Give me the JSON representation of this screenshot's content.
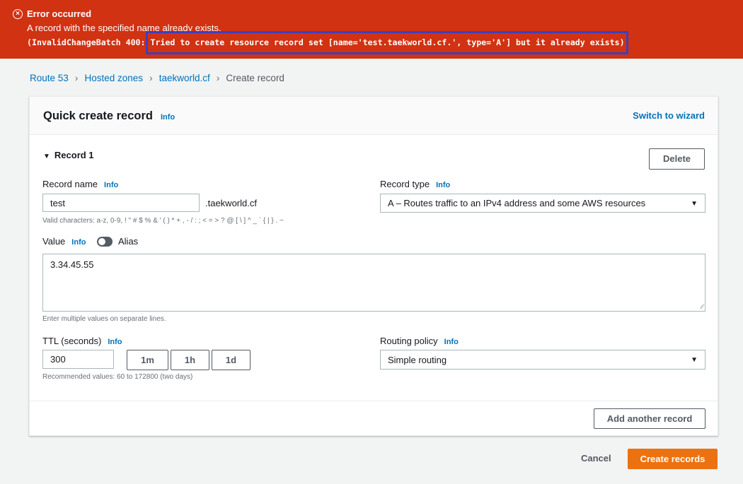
{
  "error": {
    "title": "Error occurred",
    "message": "A record with the specified name already exists.",
    "code_prefix": "(InvalidChangeBatch 400: ",
    "code_detail": "Tried to create resource record set [name='test.taekworld.cf.', type='A'] but it already exists)"
  },
  "breadcrumb": [
    "Route 53",
    "Hosted zones",
    "taekworld.cf",
    "Create record"
  ],
  "panel": {
    "title": "Quick create record",
    "info": "Info",
    "switch_wizard": "Switch to wizard",
    "record_title": "Record 1",
    "delete_label": "Delete"
  },
  "record_name": {
    "label": "Record name",
    "value": "test",
    "suffix": ".taekworld.cf",
    "hint": "Valid characters: a-z, 0-9, ! \" # $ % & ' ( ) * + , - / : ; < = > ? @ [ \\ ] ^ _ ` { | } . ~"
  },
  "record_type": {
    "label": "Record type",
    "value": "A – Routes traffic to an IPv4 address and some AWS resources"
  },
  "value": {
    "label": "Value",
    "alias_label": "Alias",
    "text": "3.34.45.55",
    "hint": "Enter multiple values on separate lines."
  },
  "ttl": {
    "label": "TTL (seconds)",
    "value": "300",
    "presets": [
      "1m",
      "1h",
      "1d"
    ],
    "hint": "Recommended values: 60 to 172800 (two days)"
  },
  "routing_policy": {
    "label": "Routing policy",
    "value": "Simple routing"
  },
  "actions": {
    "add_another": "Add another record",
    "cancel": "Cancel",
    "create": "Create records"
  }
}
